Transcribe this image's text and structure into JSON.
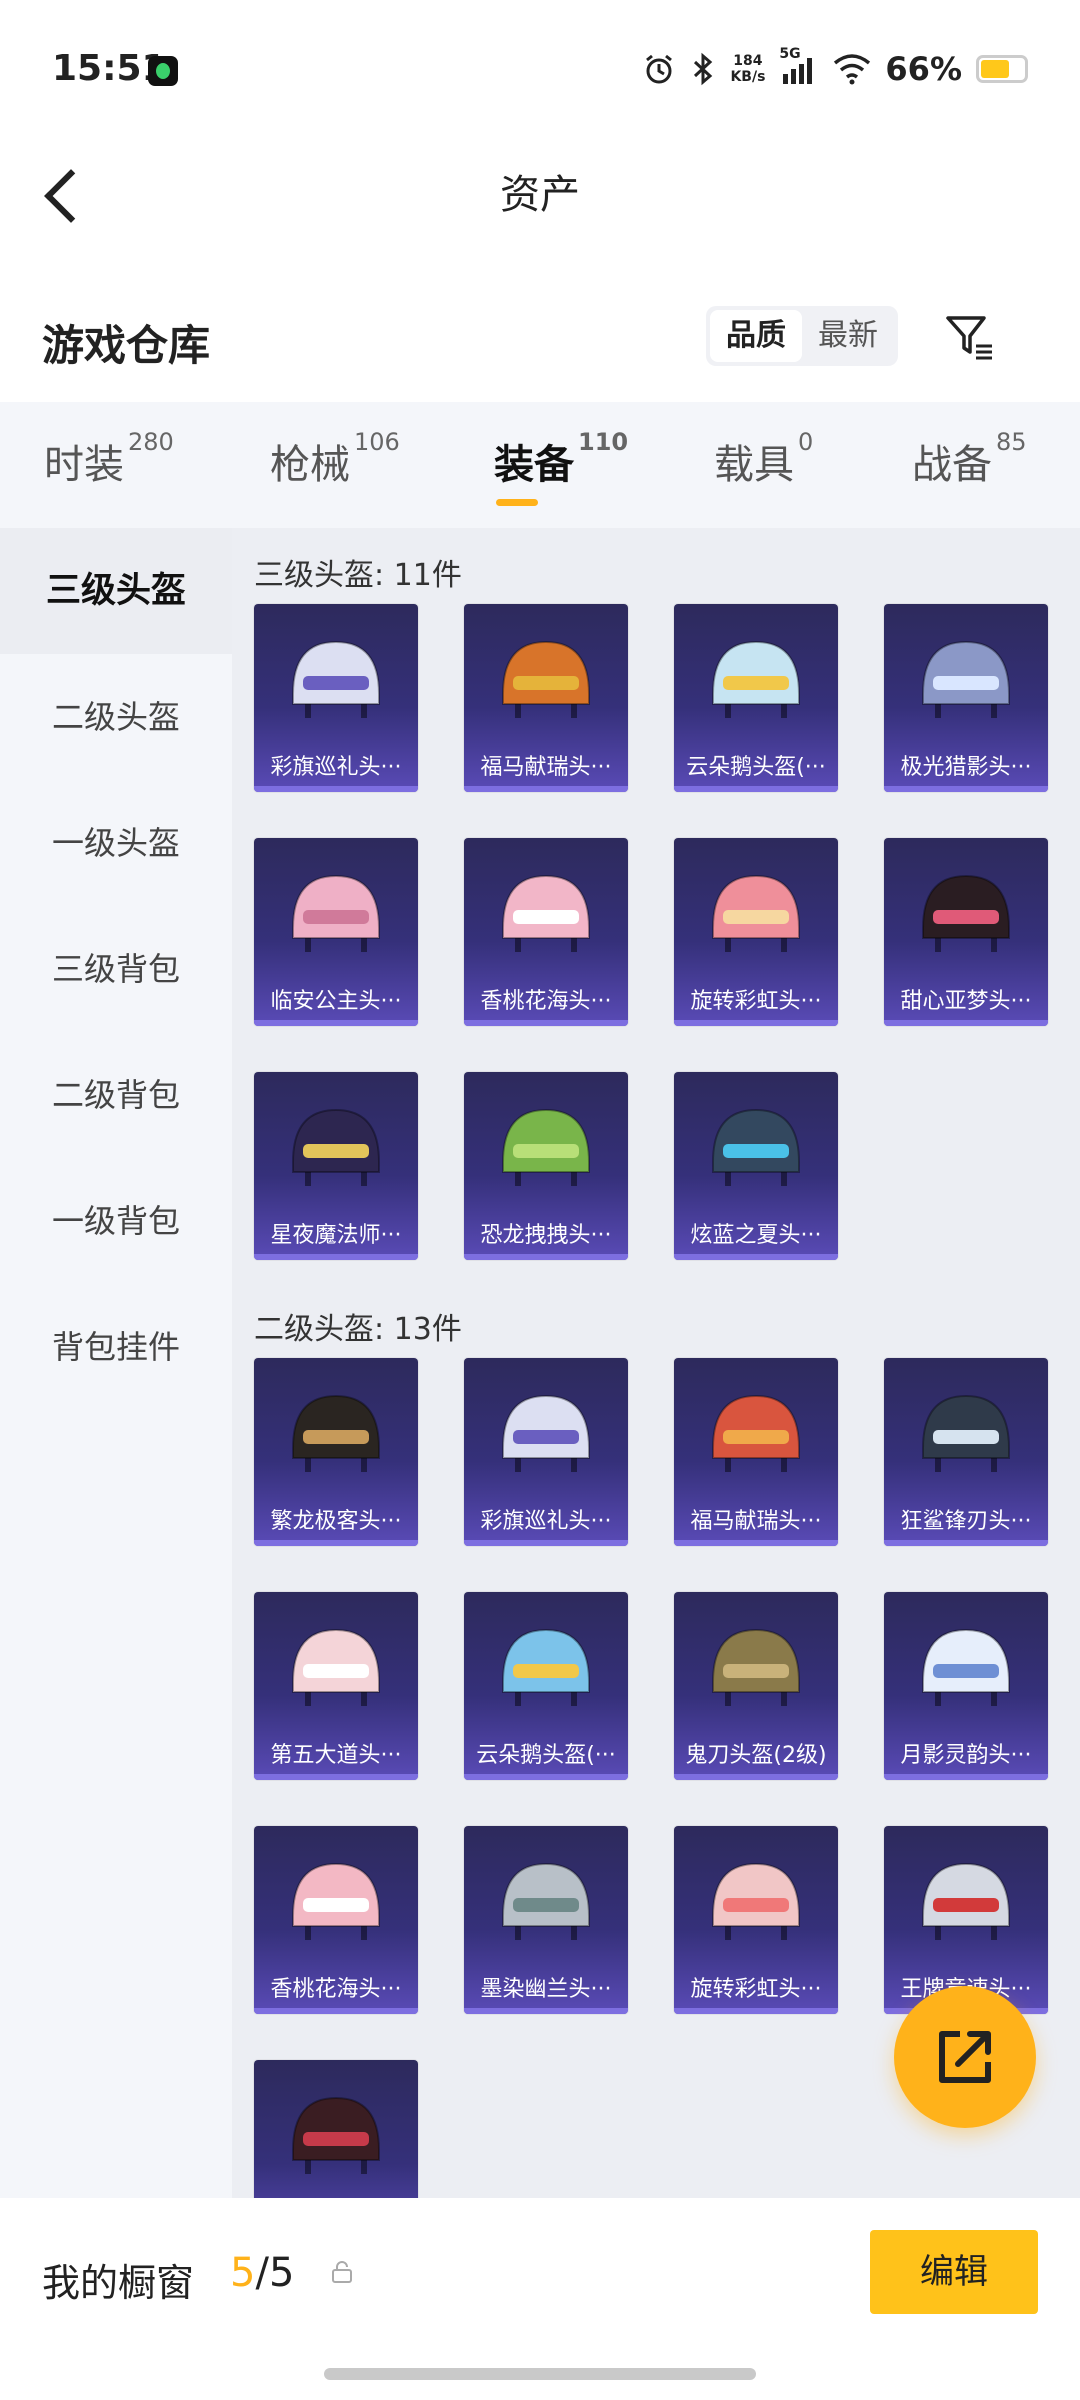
{
  "status_bar": {
    "time": "15:51",
    "net_speed_value": "184",
    "net_speed_unit": "KB/s",
    "network": "5G",
    "battery": "66%",
    "battery_level": 0.66
  },
  "header": {
    "title": "资产"
  },
  "section": {
    "title": "游戏仓库",
    "sort_options": [
      "品质",
      "最新"
    ],
    "active_sort": "品质"
  },
  "tabs": [
    {
      "label": "时装",
      "count": "280",
      "active": false
    },
    {
      "label": "枪械",
      "count": "106",
      "active": false
    },
    {
      "label": "装备",
      "count": "110",
      "active": true
    },
    {
      "label": "载具",
      "count": "0",
      "active": false
    },
    {
      "label": "战备",
      "count": "85",
      "active": false
    }
  ],
  "sidebar": {
    "items": [
      {
        "label": "三级头盔",
        "active": true
      },
      {
        "label": "二级头盔",
        "active": false
      },
      {
        "label": "一级头盔",
        "active": false
      },
      {
        "label": "三级背包",
        "active": false
      },
      {
        "label": "二级背包",
        "active": false
      },
      {
        "label": "一级背包",
        "active": false
      },
      {
        "label": "背包挂件",
        "active": false
      }
    ]
  },
  "groups": [
    {
      "label": "三级头盔: 11件",
      "items": [
        {
          "name": "彩旗巡礼头···",
          "color": "#dcdff2",
          "accent": "#6a5fc0"
        },
        {
          "name": "福马献瑞头···",
          "color": "#d8742a",
          "accent": "#e5b33a"
        },
        {
          "name": "云朵鹅头盔(···",
          "color": "#c6e4f2",
          "accent": "#f1c84a"
        },
        {
          "name": "极光猎影头···",
          "color": "#8b98c7",
          "accent": "#d9e6ff"
        },
        {
          "name": "临安公主头···",
          "color": "#efb0c6",
          "accent": "#d07a9a"
        },
        {
          "name": "香桃花海头···",
          "color": "#f2b6c8",
          "accent": "#ffffff"
        },
        {
          "name": "旋转彩虹头···",
          "color": "#ef8f9a",
          "accent": "#f6d7a0"
        },
        {
          "name": "甜心亚梦头···",
          "color": "#2a1d22",
          "accent": "#e05a78"
        },
        {
          "name": "星夜魔法师···",
          "color": "#2d2650",
          "accent": "#e2c45a"
        },
        {
          "name": "恐龙拽拽头···",
          "color": "#79b54a",
          "accent": "#b8df78"
        },
        {
          "name": "炫蓝之夏头···",
          "color": "#33485f",
          "accent": "#4ac1e8"
        }
      ]
    },
    {
      "label": "二级头盔: 13件",
      "items": [
        {
          "name": "繁龙极客头···",
          "color": "#2a2521",
          "accent": "#c69a5a"
        },
        {
          "name": "彩旗巡礼头···",
          "color": "#dcdff2",
          "accent": "#6a5fc0"
        },
        {
          "name": "福马献瑞头···",
          "color": "#d9553e",
          "accent": "#f0a94a"
        },
        {
          "name": "狂鲨锋刃头···",
          "color": "#2f3a4a",
          "accent": "#d6e3ef"
        },
        {
          "name": "第五大道头···",
          "color": "#f4d4d8",
          "accent": "#ffffff"
        },
        {
          "name": "云朵鹅头盔(···",
          "color": "#7cc3ea",
          "accent": "#f1c84a"
        },
        {
          "name": "鬼刀头盔(2级)",
          "color": "#8a7a4a",
          "accent": "#c9b27a"
        },
        {
          "name": "月影灵韵头···",
          "color": "#e6eefb",
          "accent": "#6e8fd4"
        },
        {
          "name": "香桃花海头···",
          "color": "#f3b8c4",
          "accent": "#ffffff"
        },
        {
          "name": "墨染幽兰头···",
          "color": "#b8c0c8",
          "accent": "#6f8a8a"
        },
        {
          "name": "旋转彩虹头···",
          "color": "#f1c6c6",
          "accent": "#f07878"
        },
        {
          "name": "王牌竞速头···",
          "color": "#d5d9e2",
          "accent": "#d23a3a"
        },
        {
          "name": "",
          "color": "#3a1d22",
          "accent": "#c63a4a"
        }
      ]
    }
  ],
  "bottom": {
    "window_label": "我的橱窗",
    "current": "5",
    "separator": "/",
    "total": "5",
    "edit_label": "编辑"
  },
  "colors": {
    "accent": "#ffb21a",
    "card_bg": "#35307a"
  }
}
